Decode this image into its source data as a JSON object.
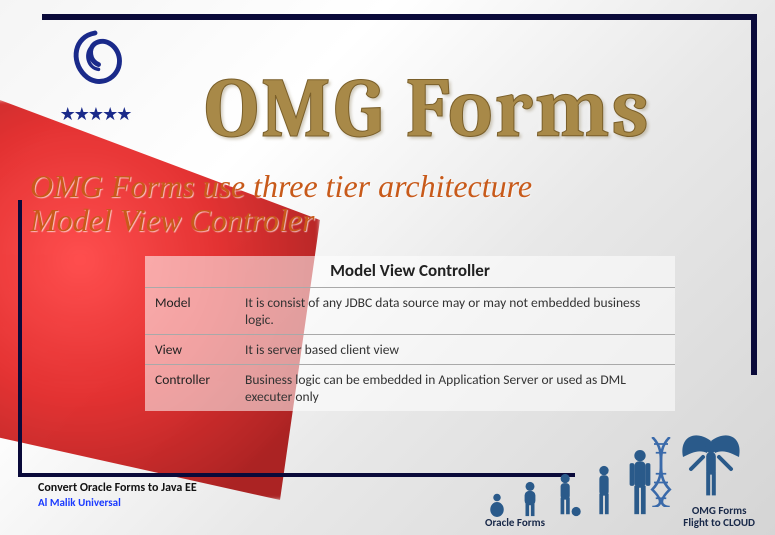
{
  "title": "OMG Forms",
  "subtitle_line1": "OMG Forms use three tier architecture",
  "subtitle_line2": "Model View Controler",
  "table": {
    "heading": "Model View Controller",
    "rows": [
      {
        "name": "Model",
        "desc": "It is consist of any JDBC data source may or may not embedded business logic."
      },
      {
        "name": "View",
        "desc": "It is server based client view"
      },
      {
        "name": "Controller",
        "desc": "Business logic can be embedded in Application Server or used as DML executer only"
      }
    ]
  },
  "footer": {
    "line1": "Convert Oracle Forms to Java EE",
    "line2": "Al Malik Universal"
  },
  "labels": {
    "oracle": "Oracle Forms",
    "cloud_line1": "OMG Forms",
    "cloud_line2": "Flight to CLOUD"
  }
}
